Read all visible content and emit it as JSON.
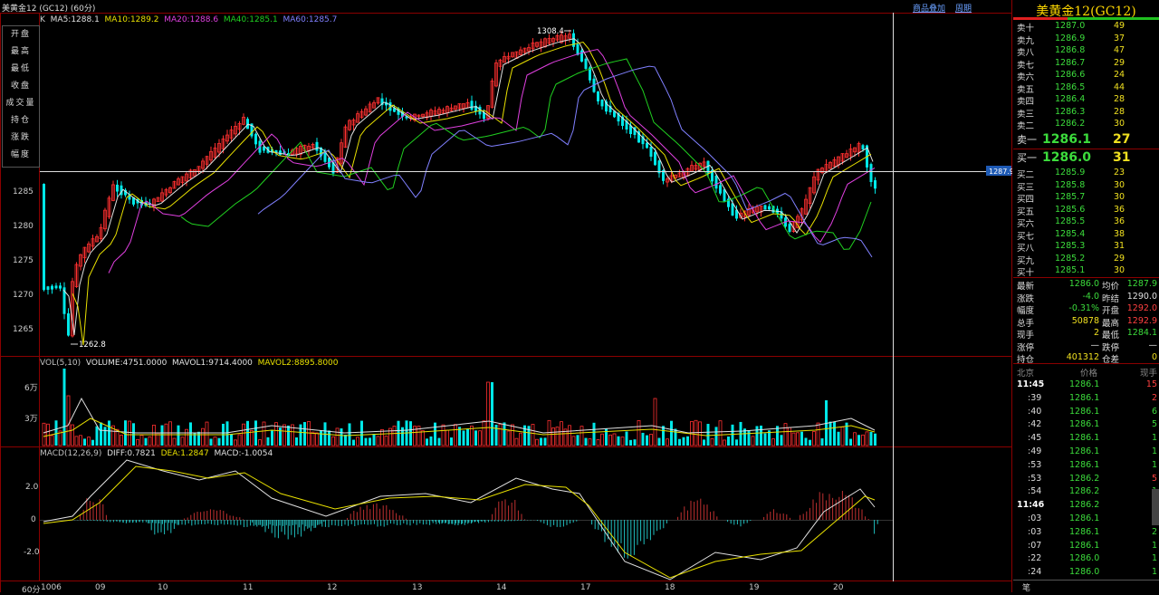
{
  "window": {
    "title": "美黄金12 (GC12) (60分)",
    "links": [
      "商品叠加",
      "周期"
    ]
  },
  "ma_legend": {
    "prefix": "K",
    "items": [
      {
        "text": "MA5:1288.1",
        "color": "#e0e0e0"
      },
      {
        "text": "MA10:1289.2",
        "color": "#e8e000"
      },
      {
        "text": "MA20:1288.6",
        "color": "#e040e0"
      },
      {
        "text": "MA40:1285.1",
        "color": "#20d020"
      },
      {
        "text": "MA60:1285.7",
        "color": "#8080ff"
      }
    ]
  },
  "info_box": [
    "开盘",
    "最高",
    "最低",
    "收盘",
    "成交量",
    "持仓",
    "涨跌",
    "幅度"
  ],
  "price_axis": [
    "1285",
    "1280",
    "1275",
    "1270",
    "1265"
  ],
  "annotations": {
    "high": "1308.4",
    "low": "1262.8",
    "crosshair_price": "1287.9"
  },
  "volume_legend": {
    "items": [
      {
        "text": "VOL(5,10)",
        "color": "#c0c0c0"
      },
      {
        "text": "VOLUME:4751.0000",
        "color": "#e0e0e0"
      },
      {
        "text": "MAVOL1:9714.4000",
        "color": "#e0e0e0"
      },
      {
        "text": "MAVOL2:8895.8000",
        "color": "#e8e000"
      }
    ],
    "axis": [
      "6万",
      "3万"
    ]
  },
  "macd_legend": {
    "items": [
      {
        "text": "MACD(12,26,9)",
        "color": "#c0c0c0"
      },
      {
        "text": "DIFF:0.7821",
        "color": "#e0e0e0"
      },
      {
        "text": "DEA:1.2847",
        "color": "#e8e000"
      },
      {
        "text": "MACD:-1.0054",
        "color": "#e0e0e0"
      }
    ],
    "axis": [
      "2.0",
      "0",
      "-2.0"
    ]
  },
  "x_axis": [
    "60分",
    "1006",
    "09",
    "10",
    "11",
    "12",
    "13",
    "14",
    "17",
    "18",
    "19",
    "20"
  ],
  "quote": {
    "symbol": "美黄金12(GC12)",
    "asks": [
      {
        "label": "卖十",
        "price": "1287.0",
        "qty": "49"
      },
      {
        "label": "卖九",
        "price": "1286.9",
        "qty": "37"
      },
      {
        "label": "卖八",
        "price": "1286.8",
        "qty": "47"
      },
      {
        "label": "卖七",
        "price": "1286.7",
        "qty": "29"
      },
      {
        "label": "卖六",
        "price": "1286.6",
        "qty": "24"
      },
      {
        "label": "卖五",
        "price": "1286.5",
        "qty": "44"
      },
      {
        "label": "卖四",
        "price": "1286.4",
        "qty": "28"
      },
      {
        "label": "卖三",
        "price": "1286.3",
        "qty": "28"
      },
      {
        "label": "卖二",
        "price": "1286.2",
        "qty": "30"
      },
      {
        "label": "卖一",
        "price": "1286.1",
        "qty": "27"
      }
    ],
    "bids": [
      {
        "label": "买一",
        "price": "1286.0",
        "qty": "31"
      },
      {
        "label": "买二",
        "price": "1285.9",
        "qty": "23"
      },
      {
        "label": "买三",
        "price": "1285.8",
        "qty": "30"
      },
      {
        "label": "买四",
        "price": "1285.7",
        "qty": "30"
      },
      {
        "label": "买五",
        "price": "1285.6",
        "qty": "36"
      },
      {
        "label": "买六",
        "price": "1285.5",
        "qty": "36"
      },
      {
        "label": "买七",
        "price": "1285.4",
        "qty": "38"
      },
      {
        "label": "买八",
        "price": "1285.3",
        "qty": "31"
      },
      {
        "label": "买九",
        "price": "1285.2",
        "qty": "29"
      },
      {
        "label": "买十",
        "price": "1285.1",
        "qty": "30"
      }
    ],
    "stats": [
      {
        "l1": "最新",
        "v1": "1286.0",
        "c1": "#3cdc3c",
        "l2": "均价",
        "v2": "1287.9",
        "c2": "#3cdc3c"
      },
      {
        "l1": "涨跌",
        "v1": "-4.0",
        "c1": "#3cdc3c",
        "l2": "昨结",
        "v2": "1290.0",
        "c2": "#e0e0e0"
      },
      {
        "l1": "幅度",
        "v1": "-0.31%",
        "c1": "#3cdc3c",
        "l2": "开盘",
        "v2": "1292.0",
        "c2": "#ff4040"
      },
      {
        "l1": "总手",
        "v1": "50878",
        "c1": "#f0e020",
        "l2": "最高",
        "v2": "1292.9",
        "c2": "#ff4040"
      },
      {
        "l1": "现手",
        "v1": "2",
        "c1": "#f0e020",
        "l2": "最低",
        "v2": "1284.1",
        "c2": "#3cdc3c"
      },
      {
        "l1": "涨停",
        "v1": "—",
        "c1": "#e0e0e0",
        "l2": "跌停",
        "v2": "—",
        "c2": "#e0e0e0"
      },
      {
        "l1": "持仓",
        "v1": "401312",
        "c1": "#f0e020",
        "l2": "仓差",
        "v2": "0",
        "c2": "#f0e020"
      }
    ],
    "ticks_header": {
      "time": "北京",
      "price": "价格",
      "qty": "现手"
    },
    "ticks": [
      {
        "time": "11:45",
        "price": "1286.1",
        "qty": "15",
        "c": "#ff4040"
      },
      {
        "time": ":39",
        "price": "1286.1",
        "qty": "2",
        "c": "#ff4040"
      },
      {
        "time": ":40",
        "price": "1286.1",
        "qty": "6",
        "c": "#3cdc3c"
      },
      {
        "time": ":42",
        "price": "1286.1",
        "qty": "5",
        "c": "#3cdc3c"
      },
      {
        "time": ":45",
        "price": "1286.1",
        "qty": "1",
        "c": "#3cdc3c"
      },
      {
        "time": ":49",
        "price": "1286.1",
        "qty": "1",
        "c": "#3cdc3c"
      },
      {
        "time": ":53",
        "price": "1286.1",
        "qty": "1",
        "c": "#3cdc3c"
      },
      {
        "time": ":53",
        "price": "1286.2",
        "qty": "5",
        "c": "#ff4040"
      },
      {
        "time": ":54",
        "price": "1286.2",
        "qty": "1",
        "c": "#3cdc3c"
      },
      {
        "time": "11:46",
        "price": "1286.2",
        "qty": "1",
        "c": "#3cdc3c"
      },
      {
        "time": ":03",
        "price": "1286.1",
        "qty": "1",
        "c": "#3cdc3c"
      },
      {
        "time": ":03",
        "price": "1286.1",
        "qty": "2",
        "c": "#3cdc3c"
      },
      {
        "time": ":07",
        "price": "1286.1",
        "qty": "1",
        "c": "#3cdc3c"
      },
      {
        "time": ":22",
        "price": "1286.0",
        "qty": "1",
        "c": "#3cdc3c"
      },
      {
        "time": ":24",
        "price": "1286.0",
        "qty": "1",
        "c": "#3cdc3c"
      }
    ],
    "footer": "笔"
  }
}
